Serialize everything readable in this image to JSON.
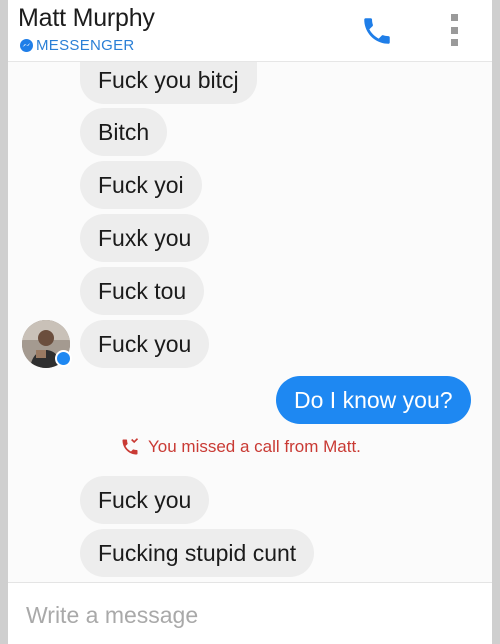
{
  "header": {
    "contact_name": "Matt Murphy",
    "app_label": "MESSENGER",
    "call_icon": "phone-icon",
    "menu_icon": "overflow-menu-icon",
    "accent_color": "#1f7ee8"
  },
  "messages": [
    {
      "direction": "incoming",
      "text": "Fuck you bitcj"
    },
    {
      "direction": "incoming",
      "text": "Bitch"
    },
    {
      "direction": "incoming",
      "text": "Fuck yoi"
    },
    {
      "direction": "incoming",
      "text": "Fuxk you"
    },
    {
      "direction": "incoming",
      "text": "Fuck tou"
    },
    {
      "direction": "incoming",
      "text": "Fuck you"
    },
    {
      "direction": "outgoing",
      "text": "Do I know you?"
    },
    {
      "direction": "incoming",
      "text": "Fuck you"
    },
    {
      "direction": "incoming",
      "text": "Fucking stupid cunt"
    }
  ],
  "missed_call": {
    "text": "You missed a call from Matt.",
    "icon": "missed-call-icon",
    "color": "#c93a34"
  },
  "composer": {
    "placeholder": "Write a message",
    "value": ""
  },
  "colors": {
    "incoming_bubble": "#ededed",
    "outgoing_bubble": "#1e88f2"
  }
}
